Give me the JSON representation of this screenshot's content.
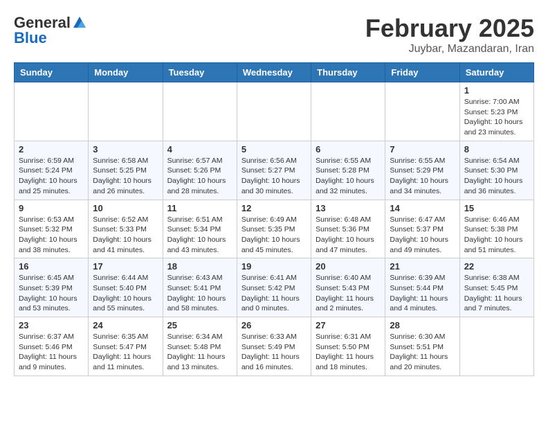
{
  "header": {
    "logo_general": "General",
    "logo_blue": "Blue",
    "month": "February 2025",
    "location": "Juybar, Mazandaran, Iran"
  },
  "weekdays": [
    "Sunday",
    "Monday",
    "Tuesday",
    "Wednesday",
    "Thursday",
    "Friday",
    "Saturday"
  ],
  "weeks": [
    [
      {
        "day": "",
        "info": ""
      },
      {
        "day": "",
        "info": ""
      },
      {
        "day": "",
        "info": ""
      },
      {
        "day": "",
        "info": ""
      },
      {
        "day": "",
        "info": ""
      },
      {
        "day": "",
        "info": ""
      },
      {
        "day": "1",
        "info": "Sunrise: 7:00 AM\nSunset: 5:23 PM\nDaylight: 10 hours\nand 23 minutes."
      }
    ],
    [
      {
        "day": "2",
        "info": "Sunrise: 6:59 AM\nSunset: 5:24 PM\nDaylight: 10 hours\nand 25 minutes."
      },
      {
        "day": "3",
        "info": "Sunrise: 6:58 AM\nSunset: 5:25 PM\nDaylight: 10 hours\nand 26 minutes."
      },
      {
        "day": "4",
        "info": "Sunrise: 6:57 AM\nSunset: 5:26 PM\nDaylight: 10 hours\nand 28 minutes."
      },
      {
        "day": "5",
        "info": "Sunrise: 6:56 AM\nSunset: 5:27 PM\nDaylight: 10 hours\nand 30 minutes."
      },
      {
        "day": "6",
        "info": "Sunrise: 6:55 AM\nSunset: 5:28 PM\nDaylight: 10 hours\nand 32 minutes."
      },
      {
        "day": "7",
        "info": "Sunrise: 6:55 AM\nSunset: 5:29 PM\nDaylight: 10 hours\nand 34 minutes."
      },
      {
        "day": "8",
        "info": "Sunrise: 6:54 AM\nSunset: 5:30 PM\nDaylight: 10 hours\nand 36 minutes."
      }
    ],
    [
      {
        "day": "9",
        "info": "Sunrise: 6:53 AM\nSunset: 5:32 PM\nDaylight: 10 hours\nand 38 minutes."
      },
      {
        "day": "10",
        "info": "Sunrise: 6:52 AM\nSunset: 5:33 PM\nDaylight: 10 hours\nand 41 minutes."
      },
      {
        "day": "11",
        "info": "Sunrise: 6:51 AM\nSunset: 5:34 PM\nDaylight: 10 hours\nand 43 minutes."
      },
      {
        "day": "12",
        "info": "Sunrise: 6:49 AM\nSunset: 5:35 PM\nDaylight: 10 hours\nand 45 minutes."
      },
      {
        "day": "13",
        "info": "Sunrise: 6:48 AM\nSunset: 5:36 PM\nDaylight: 10 hours\nand 47 minutes."
      },
      {
        "day": "14",
        "info": "Sunrise: 6:47 AM\nSunset: 5:37 PM\nDaylight: 10 hours\nand 49 minutes."
      },
      {
        "day": "15",
        "info": "Sunrise: 6:46 AM\nSunset: 5:38 PM\nDaylight: 10 hours\nand 51 minutes."
      }
    ],
    [
      {
        "day": "16",
        "info": "Sunrise: 6:45 AM\nSunset: 5:39 PM\nDaylight: 10 hours\nand 53 minutes."
      },
      {
        "day": "17",
        "info": "Sunrise: 6:44 AM\nSunset: 5:40 PM\nDaylight: 10 hours\nand 55 minutes."
      },
      {
        "day": "18",
        "info": "Sunrise: 6:43 AM\nSunset: 5:41 PM\nDaylight: 10 hours\nand 58 minutes."
      },
      {
        "day": "19",
        "info": "Sunrise: 6:41 AM\nSunset: 5:42 PM\nDaylight: 11 hours\nand 0 minutes."
      },
      {
        "day": "20",
        "info": "Sunrise: 6:40 AM\nSunset: 5:43 PM\nDaylight: 11 hours\nand 2 minutes."
      },
      {
        "day": "21",
        "info": "Sunrise: 6:39 AM\nSunset: 5:44 PM\nDaylight: 11 hours\nand 4 minutes."
      },
      {
        "day": "22",
        "info": "Sunrise: 6:38 AM\nSunset: 5:45 PM\nDaylight: 11 hours\nand 7 minutes."
      }
    ],
    [
      {
        "day": "23",
        "info": "Sunrise: 6:37 AM\nSunset: 5:46 PM\nDaylight: 11 hours\nand 9 minutes."
      },
      {
        "day": "24",
        "info": "Sunrise: 6:35 AM\nSunset: 5:47 PM\nDaylight: 11 hours\nand 11 minutes."
      },
      {
        "day": "25",
        "info": "Sunrise: 6:34 AM\nSunset: 5:48 PM\nDaylight: 11 hours\nand 13 minutes."
      },
      {
        "day": "26",
        "info": "Sunrise: 6:33 AM\nSunset: 5:49 PM\nDaylight: 11 hours\nand 16 minutes."
      },
      {
        "day": "27",
        "info": "Sunrise: 6:31 AM\nSunset: 5:50 PM\nDaylight: 11 hours\nand 18 minutes."
      },
      {
        "day": "28",
        "info": "Sunrise: 6:30 AM\nSunset: 5:51 PM\nDaylight: 11 hours\nand 20 minutes."
      },
      {
        "day": "",
        "info": ""
      }
    ]
  ]
}
